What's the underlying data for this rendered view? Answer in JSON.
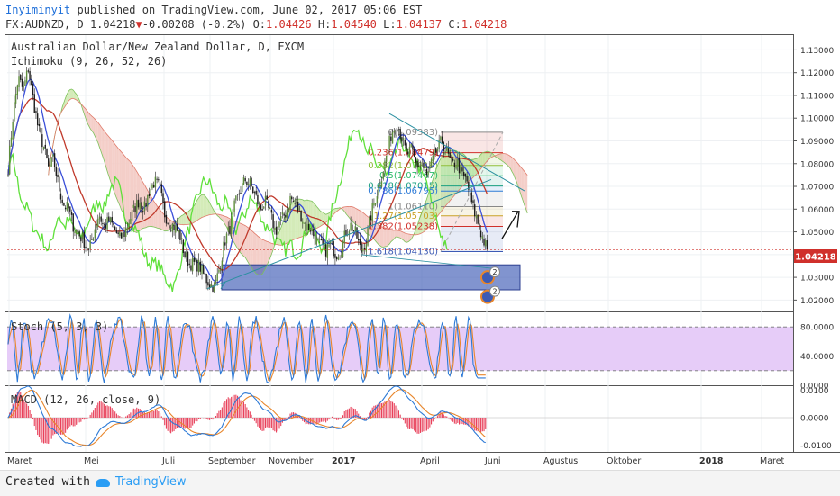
{
  "header": {
    "user": "Inyiminyit",
    "published": " published on TradingView.com, June 02, 2017 05:06 EST",
    "symbol": "FX:AUDNZD, D",
    "last": "1.04218",
    "arrow": "▼",
    "change": "-0.00208 (-0.2%)",
    "o_label": "O:",
    "o": "1.04426",
    "h_label": "H:",
    "h": "1.04540",
    "l_label": "L:",
    "l": "1.04137",
    "c_label": "C:",
    "c": "1.04218"
  },
  "chart_title": "Australian Dollar/New Zealand Dollar, D, FXCM",
  "ichimoku_label": "Ichimoku (9, 26, 52, 26)",
  "stoch_label": "Stoch (5, 3, 3)",
  "macd_label": "MACD (12, 26, close, 9)",
  "price_tag": "1.04218",
  "fib_labels": [
    "0(1.09383)",
    "0.236(1.08479)",
    "0.382(1.07919)",
    "0.5(1.07467)",
    "0.618(1.07015)",
    "0.786(1.06795)",
    "1(1.06110)",
    "1.27(1.05703)",
    "1.382(1.05238)",
    "1.618(1.04130)"
  ],
  "event_badges": [
    "2",
    "2"
  ],
  "colors": {
    "up": "#5d8c3a",
    "down": "#1a1a1a",
    "tenkan": "#3a4fd8",
    "kijun": "#c0392b",
    "chikou": "#5fe03a",
    "cloud_bull": "#cfe9b0",
    "cloud_bear": "#f3c9c2",
    "stoch_k": "#2d7ad6",
    "stoch_d": "#e8862b",
    "stoch_band": "#e3c7f7",
    "macd": "#2d7ad6",
    "signal": "#e8862b",
    "hist": "#e8405a",
    "zone": "#3d5bb5",
    "price_tag_bg": "#d0302b"
  },
  "footer": {
    "created": "Created with",
    "brand": "TradingView",
    "logo_icon": "tradingview-cloud-icon"
  },
  "chart_data": [
    {
      "type": "candlestick",
      "title": "Australian Dollar/New Zealand Dollar, D, FXCM",
      "x_ticks": [
        "Maret",
        "Mei",
        "Juli",
        "September",
        "November",
        "2017",
        "April",
        "Juni",
        "Agustus",
        "Oktober",
        "2018",
        "Maret"
      ],
      "y_ticks": [
        "1.13000",
        "1.12000",
        "1.11000",
        "1.10000",
        "1.09000",
        "1.08000",
        "1.07000",
        "1.06000",
        "1.05000",
        "1.04000",
        "1.03000",
        "1.02000"
      ],
      "ylim": [
        1.015,
        1.1365
      ],
      "close_path": [
        1.078,
        1.102,
        1.118,
        1.112,
        1.122,
        1.108,
        1.095,
        1.088,
        1.078,
        1.082,
        1.07,
        1.062,
        1.06,
        1.052,
        1.049,
        1.046,
        1.041,
        1.05,
        1.058,
        1.052,
        1.055,
        1.052,
        1.047,
        1.049,
        1.055,
        1.06,
        1.064,
        1.06,
        1.068,
        1.072,
        1.07,
        1.058,
        1.054,
        1.052,
        1.049,
        1.04,
        1.036,
        1.036,
        1.035,
        1.03,
        1.027,
        1.026,
        1.035,
        1.046,
        1.052,
        1.062,
        1.068,
        1.073,
        1.071,
        1.066,
        1.06,
        1.063,
        1.058,
        1.05,
        1.055,
        1.058,
        1.065,
        1.062,
        1.058,
        1.052,
        1.052,
        1.046,
        1.044,
        1.042,
        1.045,
        1.04,
        1.042,
        1.05,
        1.053,
        1.049,
        1.041,
        1.046,
        1.058,
        1.066,
        1.074,
        1.083,
        1.093,
        1.098,
        1.092,
        1.084,
        1.086,
        1.079,
        1.08,
        1.074,
        1.08,
        1.086,
        1.09,
        1.085,
        1.079,
        1.081,
        1.075,
        1.072,
        1.062,
        1.055,
        1.048,
        1.042
      ],
      "last": 1.04218,
      "fib_retracement": [
        {
          "level": "0",
          "price": 1.09383
        },
        {
          "level": "0.236",
          "price": 1.08479
        },
        {
          "level": "0.382",
          "price": 1.07919
        },
        {
          "level": "0.5",
          "price": 1.07467
        },
        {
          "level": "0.618",
          "price": 1.07015
        },
        {
          "level": "0.786",
          "price": 1.06795
        },
        {
          "level": "1",
          "price": 1.0611
        },
        {
          "level": "1.27",
          "price": 1.05703
        },
        {
          "level": "1.382",
          "price": 1.05238
        },
        {
          "level": "1.618",
          "price": 1.0413
        }
      ],
      "support_zone": [
        1.0245,
        1.0355
      ]
    },
    {
      "type": "line",
      "title": "Stoch (5, 3, 3)",
      "y_ticks": [
        "80.0000",
        "40.0000",
        "0.0000"
      ],
      "ylim": [
        0,
        100
      ],
      "band": [
        20,
        80
      ]
    },
    {
      "type": "line",
      "title": "MACD (12, 26, close, 9)",
      "y_ticks": [
        "0.0100",
        "0.0000",
        "-0.0100"
      ],
      "ylim": [
        -0.0125,
        0.0115
      ]
    }
  ]
}
